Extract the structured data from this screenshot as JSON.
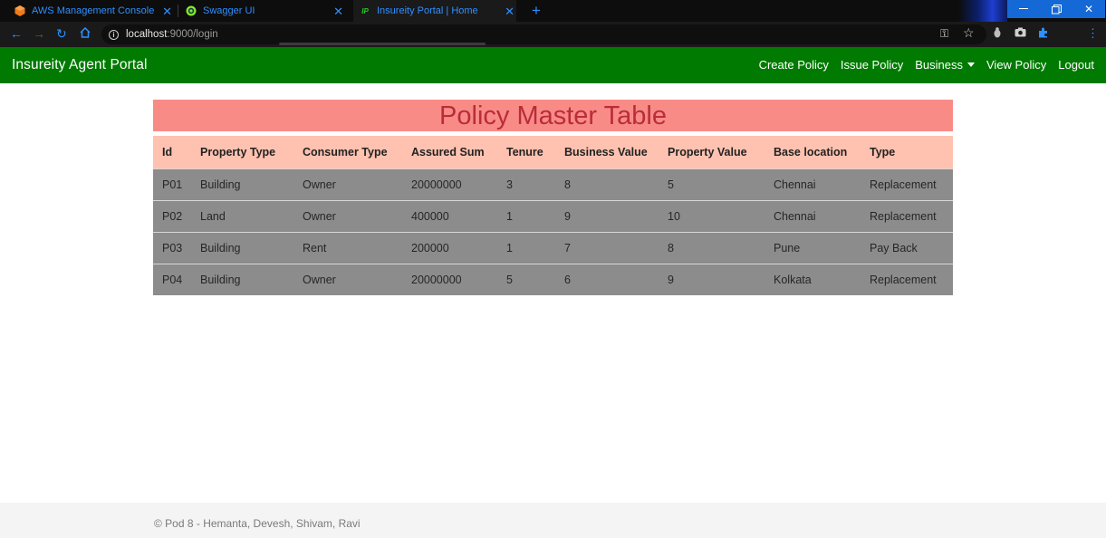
{
  "browser": {
    "tabs": [
      {
        "title": "AWS Management Console",
        "icon": "aws-cube-icon",
        "active": false
      },
      {
        "title": "Swagger UI",
        "icon": "swagger-icon",
        "active": false
      },
      {
        "title": "Insureity Portal | Home",
        "icon": "ip-logo-icon",
        "active": true
      }
    ],
    "url_host": "localhost",
    "url_path": ":9000/login",
    "accent_color": "#2f8fff"
  },
  "navbar": {
    "brand": "Insureity Agent Portal",
    "links": [
      {
        "label": "Create Policy"
      },
      {
        "label": "Issue Policy"
      },
      {
        "label": "Business",
        "dropdown": true
      },
      {
        "label": "View Policy"
      },
      {
        "label": "Logout"
      }
    ],
    "color": "#007a00"
  },
  "page": {
    "title": "Policy Master Table"
  },
  "table": {
    "headers": [
      "Id",
      "Property Type",
      "Consumer Type",
      "Assured Sum",
      "Tenure",
      "Business Value",
      "Property Value",
      "Base location",
      "Type"
    ],
    "rows": [
      [
        "P01",
        "Building",
        "Owner",
        "20000000",
        "3",
        "8",
        "5",
        "Chennai",
        "Replacement"
      ],
      [
        "P02",
        "Land",
        "Owner",
        "400000",
        "1",
        "9",
        "10",
        "Chennai",
        "Replacement"
      ],
      [
        "P03",
        "Building",
        "Rent",
        "200000",
        "1",
        "7",
        "8",
        "Pune",
        "Pay Back"
      ],
      [
        "P04",
        "Building",
        "Owner",
        "20000000",
        "5",
        "6",
        "9",
        "Kolkata",
        "Replacement"
      ]
    ]
  },
  "footer": {
    "text": "© Pod 8 - Hemanta, Devesh, Shivam, Ravi"
  }
}
